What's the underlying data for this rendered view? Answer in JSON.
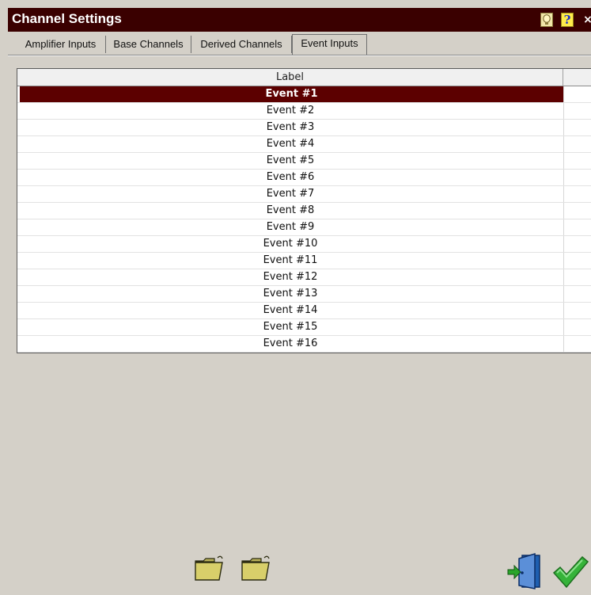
{
  "window": {
    "title": "Channel Settings",
    "hint_icon": "lightbulb-hint-icon",
    "help_label": "?",
    "close_label": "×"
  },
  "tabs": [
    {
      "label": "Amplifier Inputs",
      "active": false
    },
    {
      "label": "Base Channels",
      "active": false
    },
    {
      "label": "Derived Channels",
      "active": false
    },
    {
      "label": "Event Inputs",
      "active": true
    }
  ],
  "grid": {
    "columns": [
      "Label",
      ""
    ],
    "selected_index": 0,
    "rows": [
      "Event #1",
      "Event #2",
      "Event #3",
      "Event #4",
      "Event #5",
      "Event #6",
      "Event #7",
      "Event #8",
      "Event #9",
      "Event #10",
      "Event #11",
      "Event #12",
      "Event #13",
      "Event #14",
      "Event #15",
      "Event #16"
    ]
  },
  "footer": {
    "open_folder_icon": "open-folder-icon",
    "save_folder_icon": "save-folder-icon",
    "exit_icon": "exit-door-icon",
    "ok_icon": "checkmark-icon"
  },
  "colors": {
    "title_bg": "#3a0000",
    "selected_row": "#5c0000",
    "window_bg": "#d4d0c8"
  }
}
